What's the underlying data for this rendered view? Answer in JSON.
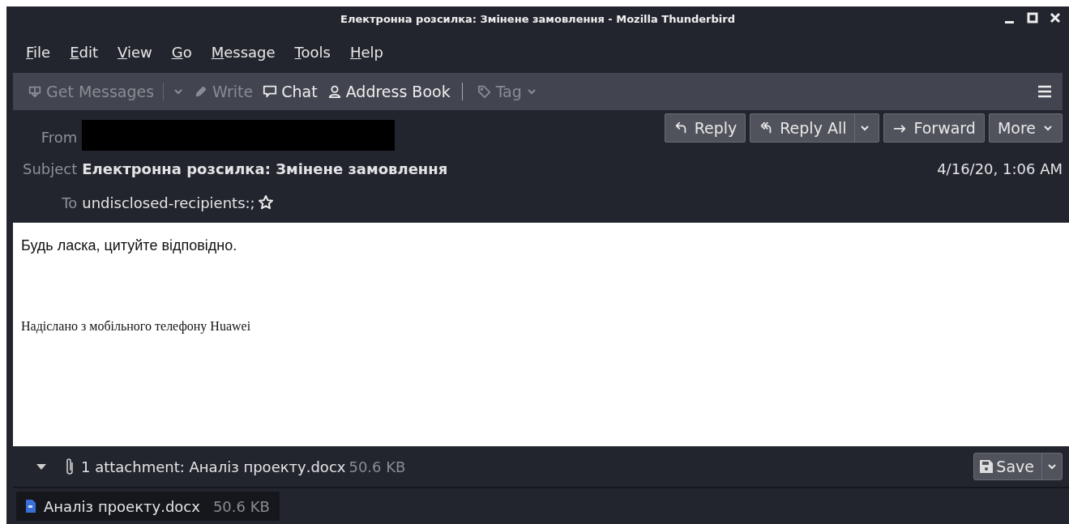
{
  "window": {
    "title": "Електронна розсилка: Змінене замовлення - Mozilla Thunderbird"
  },
  "menu": [
    "File",
    "Edit",
    "View",
    "Go",
    "Message",
    "Tools",
    "Help"
  ],
  "toolbar": [
    {
      "kind": "download",
      "label": "Get Messages",
      "disabled": true,
      "dropdown": true,
      "divider_after": false
    },
    {
      "kind": "pencil",
      "label": "Write",
      "disabled": true,
      "dropdown": false,
      "divider_after": false
    },
    {
      "kind": "chat",
      "label": "Chat",
      "disabled": false,
      "dropdown": false,
      "divider_after": false
    },
    {
      "kind": "contacts",
      "label": "Address Book",
      "disabled": false,
      "dropdown": false,
      "divider_after": true
    },
    {
      "kind": "tag",
      "label": "Tag",
      "disabled": true,
      "dropdown": true,
      "divider_after": false
    }
  ],
  "header": {
    "from_label": "From",
    "subject_label": "Subject",
    "subject": "Електронна розсилка: Змінене замовлення",
    "to_label": "To",
    "to": "undisclosed-recipients:;",
    "date": "4/16/20, 1:06 AM"
  },
  "actions": [
    {
      "kind": "reply",
      "label": "Reply",
      "dropdown": false
    },
    {
      "kind": "reply-all",
      "label": "Reply All",
      "dropdown": true
    },
    {
      "kind": "forward",
      "label": "Forward",
      "dropdown": false
    },
    {
      "kind": "more",
      "label": "More",
      "dropdown": true
    }
  ],
  "body": {
    "greeting": "Будь ласка, цитуйте відповідно.",
    "signature": "Надіслано з мобільного телефону Huawei"
  },
  "attachment_bar": {
    "summary": "1 attachment: Аналіз проекту.docx",
    "size": "50.6 KB",
    "save": "Save"
  },
  "attachments": [
    {
      "name": "Аналіз проекту.docx",
      "size": "50.6 KB"
    }
  ]
}
